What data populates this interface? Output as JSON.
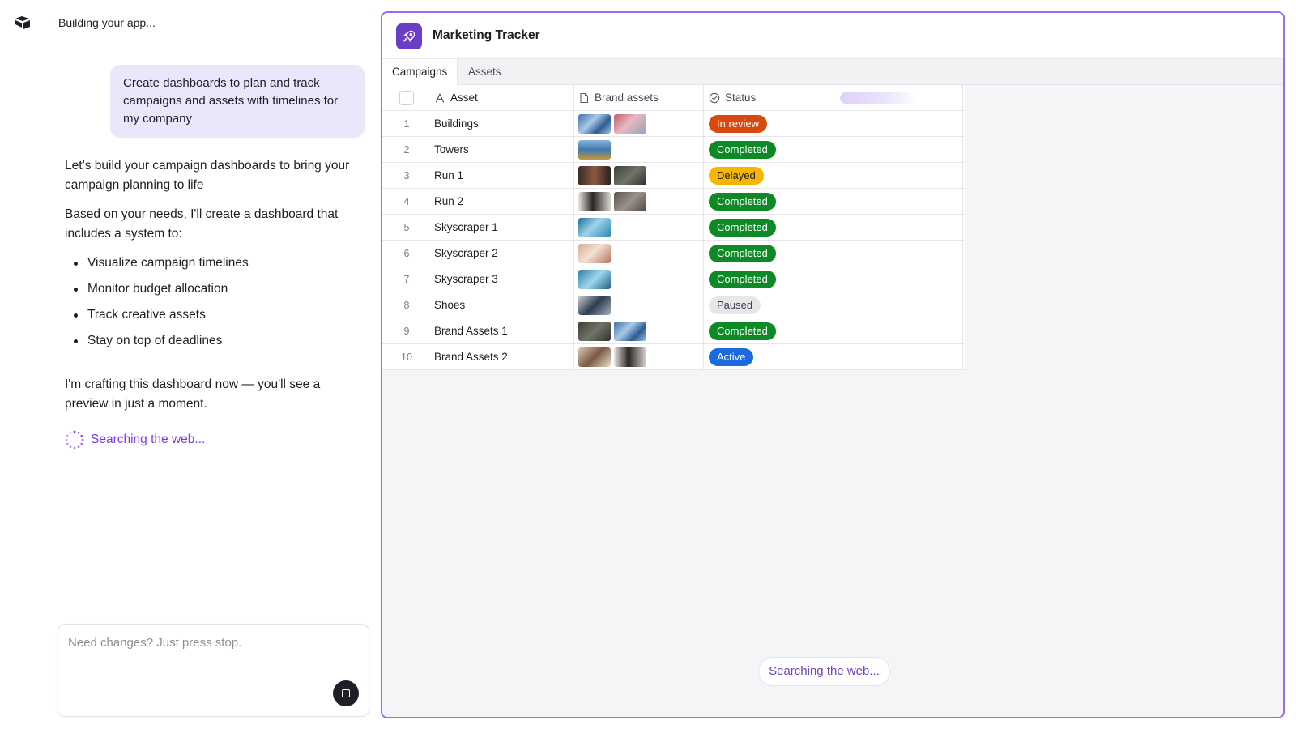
{
  "chat": {
    "title": "Building your app...",
    "user_message": "Create dashboards to plan and track campaigns and assets with timelines for my company",
    "assistant_intro": "Let’s build your campaign dashboards to bring your campaign planning to life",
    "assistant_lead": "Based on your needs, I'll create a dashboard that includes a system to:",
    "bullets": [
      "Visualize campaign timelines",
      "Monitor budget allocation",
      "Track creative assets",
      "Stay on top of deadlines"
    ],
    "assistant_outro": "I'm crafting this dashboard now — you'll see a preview in just a moment.",
    "status_text": "Searching the web...",
    "composer_placeholder": "Need changes? Just press stop."
  },
  "app": {
    "title": "Marketing Tracker",
    "tabs": [
      {
        "label": "Campaigns",
        "active": true
      },
      {
        "label": "Assets",
        "active": false
      }
    ],
    "columns": {
      "asset": "Asset",
      "brand_assets": "Brand assets",
      "status": "Status"
    },
    "rows": [
      {
        "num": "1",
        "name": "Buildings",
        "thumbs": [
          "t-blue",
          "t-pink"
        ],
        "status": "In review",
        "status_class": "b-in-review"
      },
      {
        "num": "2",
        "name": "Towers",
        "thumbs": [
          "t-tower"
        ],
        "status": "Completed",
        "status_class": "b-completed"
      },
      {
        "num": "3",
        "name": "Run 1",
        "thumbs": [
          "t-run1",
          "t-dark"
        ],
        "status": "Delayed",
        "status_class": "b-delayed"
      },
      {
        "num": "4",
        "name": "Run 2",
        "thumbs": [
          "t-person",
          "t-grey"
        ],
        "status": "Completed",
        "status_class": "b-completed"
      },
      {
        "num": "5",
        "name": "Skyscraper 1",
        "thumbs": [
          "t-sky1"
        ],
        "status": "Completed",
        "status_class": "b-completed"
      },
      {
        "num": "6",
        "name": "Skyscraper 2",
        "thumbs": [
          "t-sky2"
        ],
        "status": "Completed",
        "status_class": "b-completed"
      },
      {
        "num": "7",
        "name": "Skyscraper 3",
        "thumbs": [
          "t-sky3"
        ],
        "status": "Completed",
        "status_class": "b-completed"
      },
      {
        "num": "8",
        "name": "Shoes",
        "thumbs": [
          "t-shoes"
        ],
        "status": "Paused",
        "status_class": "b-paused"
      },
      {
        "num": "9",
        "name": "Brand Assets 1",
        "thumbs": [
          "t-dark",
          "t-blue"
        ],
        "status": "Completed",
        "status_class": "b-completed"
      },
      {
        "num": "10",
        "name": "Brand Assets 2",
        "thumbs": [
          "t-tan",
          "t-person"
        ],
        "status": "Active",
        "status_class": "b-active"
      }
    ],
    "status_pill": "Searching the web..."
  },
  "colors": {
    "accent": "#7c3aed",
    "preview_border": "#9a6cf0",
    "app_icon": "#6b3ec7",
    "user_bubble": "#ece6fb",
    "in_review": "#d9480f",
    "completed": "#0d8a25",
    "delayed": "#f5b700",
    "paused": "#e6e7ea",
    "active": "#1a6be0"
  },
  "icons": {
    "logo": "airtable-logo-icon",
    "app": "rocket-icon",
    "asset_column": "text-a-icon",
    "brand_assets_column": "file-icon",
    "status_column": "check-circle-icon",
    "stop": "stop-square-icon",
    "spinner": "loading-spinner-icon"
  }
}
